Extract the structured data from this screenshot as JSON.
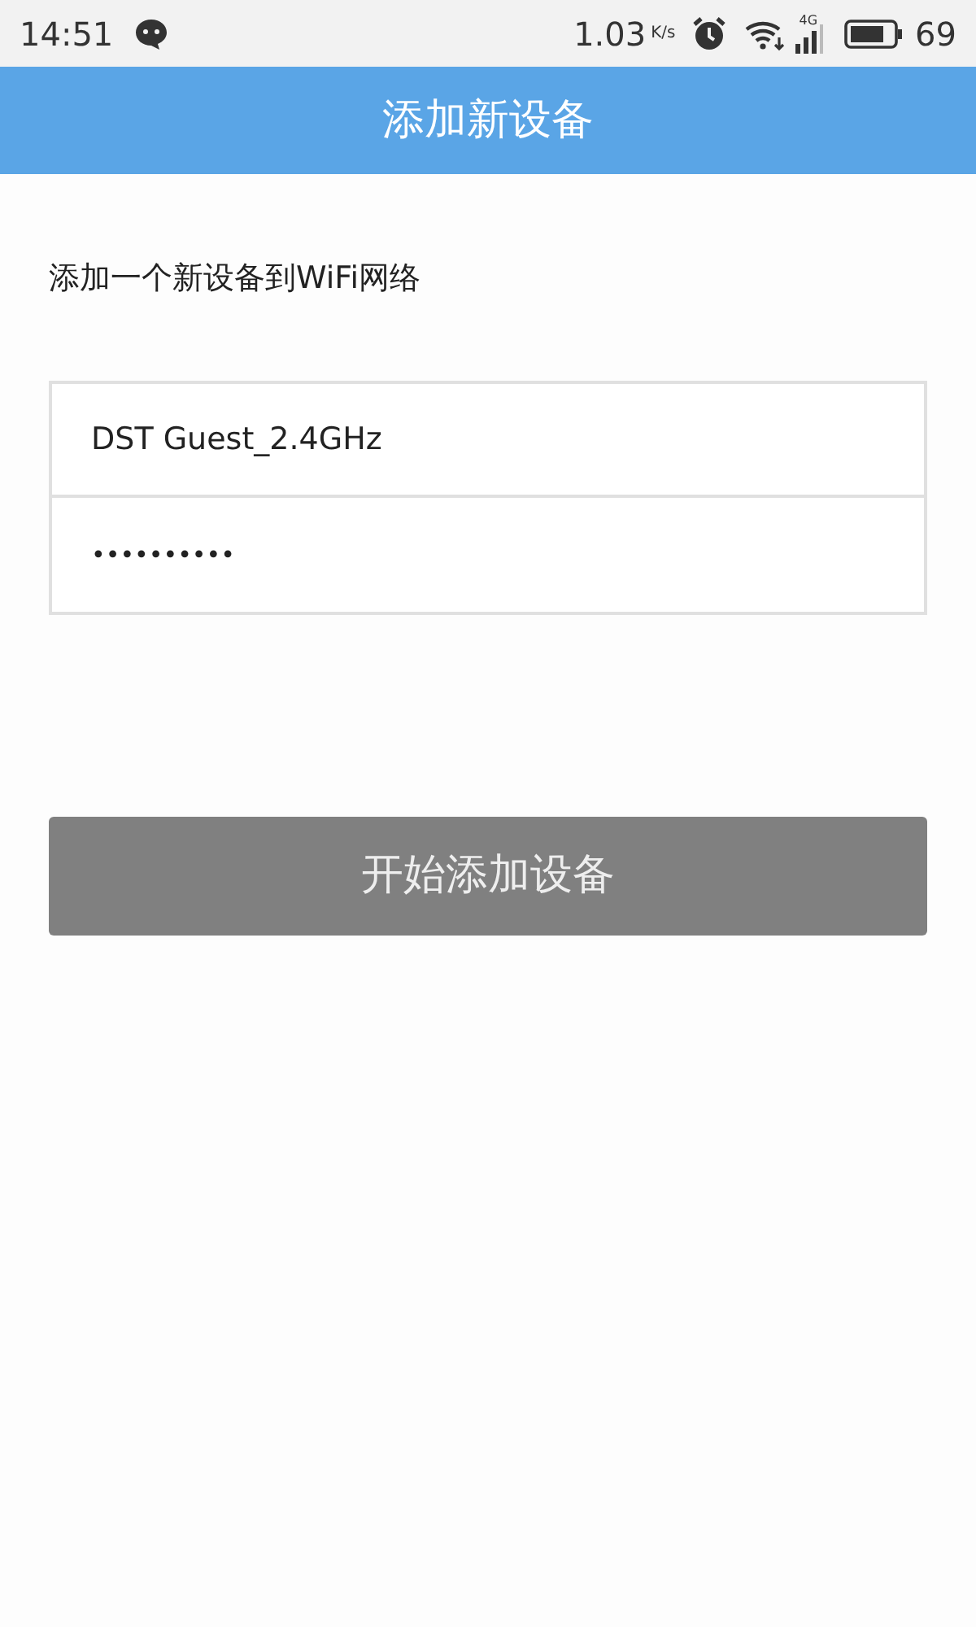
{
  "status_bar": {
    "time": "14:51",
    "speed": "1.03",
    "speed_unit": "K/s",
    "network": "4G",
    "battery": "69"
  },
  "header": {
    "title": "添加新设备"
  },
  "subtitle": "添加一个新设备到WiFi网络",
  "form": {
    "ssid": {
      "value": "DST Guest_2.4GHz"
    },
    "password": {
      "value": "••••••••••"
    }
  },
  "buttons": [
    {
      "label": "开始添加设备",
      "disabled": true
    }
  ]
}
